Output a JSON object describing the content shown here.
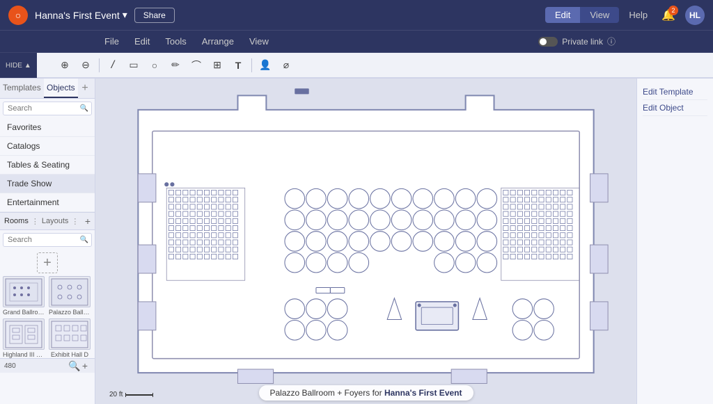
{
  "app": {
    "logo": "○",
    "event_title": "Hanna's First Event",
    "event_dropdown_icon": "▾",
    "share_label": "Share",
    "edit_label": "Edit",
    "view_label": "View",
    "help_label": "Help",
    "notif_count": "2",
    "avatar_initials": "HL"
  },
  "menu": {
    "items": [
      "File",
      "Edit",
      "Tools",
      "Arrange",
      "View"
    ],
    "private_link_label": "Private link",
    "info_icon": "ⓘ"
  },
  "toolbar": {
    "tools": [
      {
        "name": "zoom-in",
        "icon": "⊕"
      },
      {
        "name": "zoom-out",
        "icon": "⊖"
      },
      {
        "name": "separator"
      },
      {
        "name": "line-tool",
        "icon": "/"
      },
      {
        "name": "rect-tool",
        "icon": "▭"
      },
      {
        "name": "circle-tool",
        "icon": "○"
      },
      {
        "name": "pen-tool",
        "icon": "✏"
      },
      {
        "name": "bezier-tool",
        "icon": "⌒"
      },
      {
        "name": "image-tool",
        "icon": "⊞"
      },
      {
        "name": "text-tool",
        "icon": "T"
      },
      {
        "name": "separator2"
      },
      {
        "name": "user-tool",
        "icon": "👤"
      },
      {
        "name": "mask-tool",
        "icon": "⌀"
      }
    ],
    "hide_label": "HIDE",
    "hide_arrow": "▲"
  },
  "sidebar": {
    "tab_templates": "Templates",
    "tab_objects": "Objects",
    "add_label": "+",
    "search_placeholder": "Search",
    "categories": [
      {
        "id": "favorites",
        "label": "Favorites"
      },
      {
        "id": "catalogs",
        "label": "Catalogs"
      },
      {
        "id": "tables-seating",
        "label": "Tables & Seating"
      },
      {
        "id": "trade-show",
        "label": "Trade Show",
        "active": true
      },
      {
        "id": "entertainment",
        "label": "Entertainment"
      }
    ]
  },
  "rooms": {
    "rooms_label": "Rooms",
    "layouts_label": "Layouts",
    "separator": "⋮",
    "add_icon": "+",
    "search_placeholder": "Search",
    "items": [
      {
        "id": "grand-ballroom",
        "label": "Grand Ballroom..."
      },
      {
        "id": "palazzo-ballroom",
        "label": "Palazzo Ballro..."
      },
      {
        "id": "highland-iii-iv",
        "label": "Highland III & IV"
      },
      {
        "id": "exhibit-hall-d",
        "label": "Exhibit Hall D"
      }
    ]
  },
  "canvas": {
    "scale_label": "20 ft",
    "zoom_value": "480",
    "zoom_in_icon": "+",
    "zoom_out_icon": "−",
    "search_icon": "🔍"
  },
  "bottom_info": {
    "venue_label": "Palazzo Ballroom + Foyers",
    "for_text": "for",
    "event_name": "Hanna's First Event"
  },
  "right_panel": {
    "items": [
      "Edit Template",
      "Edit Object"
    ]
  }
}
